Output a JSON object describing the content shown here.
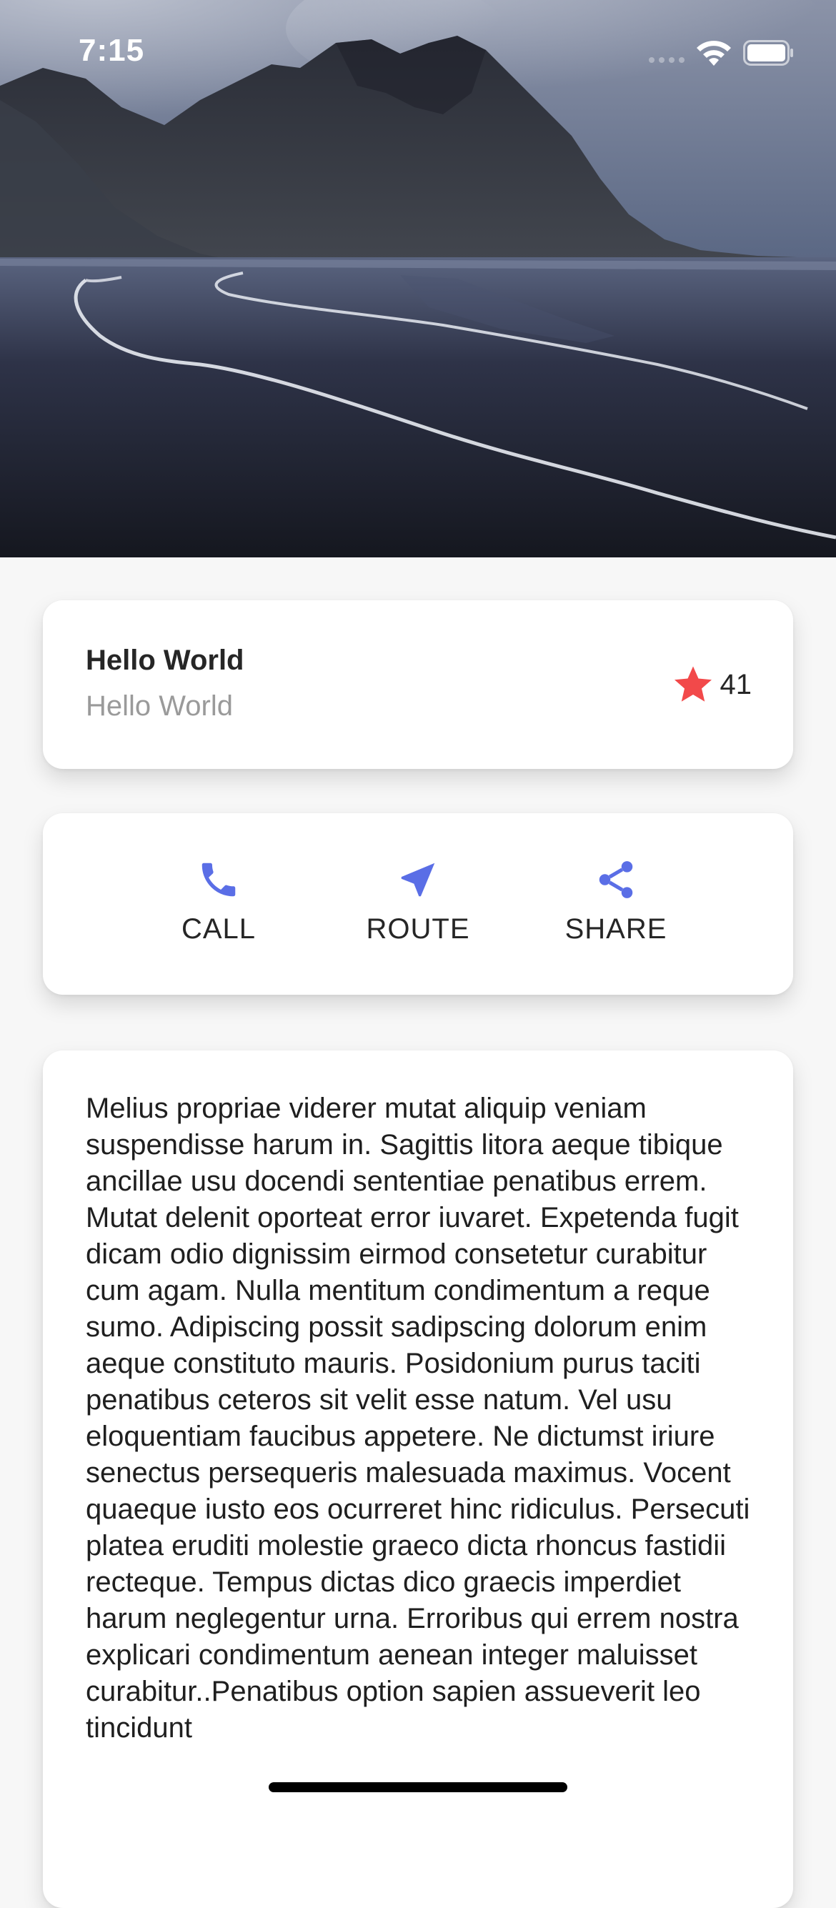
{
  "status_bar": {
    "time": "7:15"
  },
  "hero": {
    "icon": "landscape-image"
  },
  "title_card": {
    "title": "Hello World",
    "subtitle": "Hello World",
    "rating_icon": "star-icon",
    "rating_count": "41"
  },
  "actions": [
    {
      "label": "CALL",
      "icon": "phone-icon"
    },
    {
      "label": "ROUTE",
      "icon": "navigation-arrow-icon"
    },
    {
      "label": "SHARE",
      "icon": "share-icon"
    }
  ],
  "description": "Melius propriae viderer mutat aliquip veniam suspendisse harum in. Sagittis litora aeque tibique ancillae usu docendi sententiae penatibus errem. Mutat delenit oporteat error iuvaret. Expetenda fugit dicam odio dignissim eirmod consetetur curabitur cum agam. Nulla mentitum condimentum a reque sumo. Adipiscing possit sadipscing dolorum enim aeque constituto mauris. Posidonium purus taciti penatibus ceteros sit velit esse natum. Vel usu eloquentiam faucibus appetere. Ne dictumst iriure senectus persequeris malesuada maximus. Vocent quaeque iusto eos ocurreret hinc ridiculus. Persecuti platea eruditi molestie graeco dicta rhoncus fastidii recteque. Tempus dictas dico graecis imperdiet harum neglegentur urna. Erroribus qui errem nostra explicari condimentum aenean integer maluisset curabitur..Penatibus option sapien assueverit leo tincidunt",
  "colors": {
    "accent": "#5a6ee6",
    "star": "#f2494a",
    "text": "#262626",
    "subtitle": "#9a9a9a",
    "background": "#f7f7f7"
  }
}
